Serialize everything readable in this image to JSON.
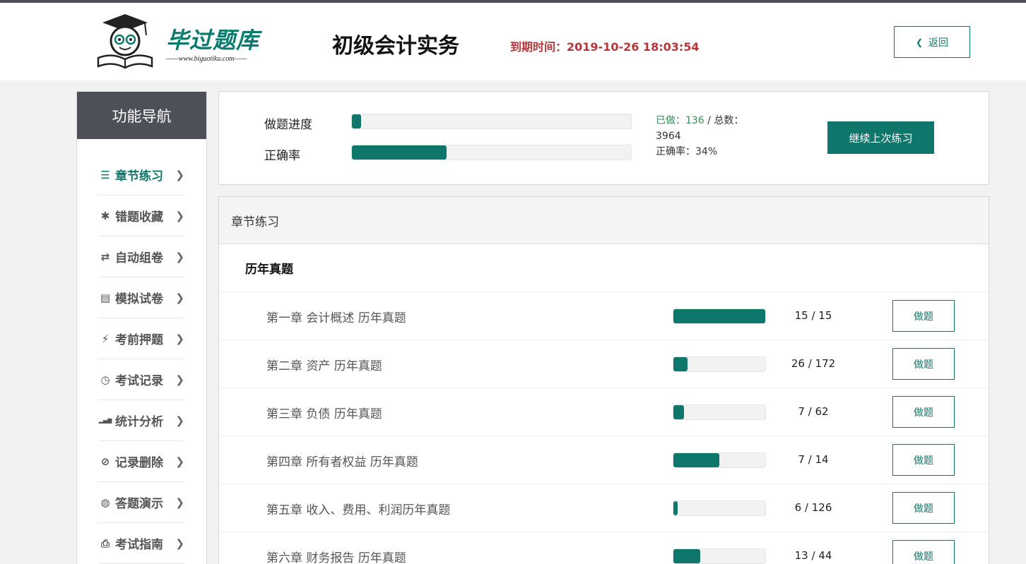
{
  "header": {
    "logo_title": "毕过题库",
    "logo_url": "——www.biguotiku.com——",
    "page_title": "初级会计实务",
    "expire_label": "到期时间：",
    "expire_value": "2019-10-26 18:03:54",
    "back_label": "返回",
    "back_icon": "chevron-left-icon"
  },
  "sidebar": {
    "title": "功能导航",
    "items": [
      {
        "label": "章节练习",
        "icon": "list-icon",
        "glyph": "☰",
        "active": true
      },
      {
        "label": "错题收藏",
        "icon": "asterisk-icon",
        "glyph": "✱",
        "active": false
      },
      {
        "label": "自动组卷",
        "icon": "retweet-icon",
        "glyph": "⇄",
        "active": false
      },
      {
        "label": "模拟试卷",
        "icon": "list-alt-icon",
        "glyph": "▤",
        "active": false
      },
      {
        "label": "考前押题",
        "icon": "flash-icon",
        "glyph": "⚡",
        "active": false
      },
      {
        "label": "考试记录",
        "icon": "clock-icon",
        "glyph": "◷",
        "active": false
      },
      {
        "label": "统计分析",
        "icon": "signal-icon",
        "glyph": "▂▄▆",
        "active": false
      },
      {
        "label": "记录删除",
        "icon": "ban-icon",
        "glyph": "⊘",
        "active": false
      },
      {
        "label": "答题演示",
        "icon": "globe-icon",
        "glyph": "◍",
        "active": false
      },
      {
        "label": "考试指南",
        "icon": "print-icon",
        "glyph": "⎙",
        "active": false
      }
    ]
  },
  "progress": {
    "progress_label": "做题进度",
    "accuracy_label": "正确率",
    "progress_fraction": 0.034,
    "accuracy_fraction": 0.34,
    "done_label": "已做：",
    "done_value": "136",
    "total_label": " / 总数：",
    "total_value": "3964",
    "accuracy_text": "正确率：34%",
    "continue_label": "继续上次练习"
  },
  "chapters": {
    "panel_title": "章节练习",
    "section_title": "历年真题",
    "button_label": "做题",
    "rows": [
      {
        "name": "第一章 会计概述 历年真题",
        "count": "15 / 15",
        "fraction": 1.0
      },
      {
        "name": "第二章 资产 历年真题",
        "count": "26 / 172",
        "fraction": 0.151
      },
      {
        "name": "第三章 负债 历年真题",
        "count": "7 / 62",
        "fraction": 0.113
      },
      {
        "name": "第四章 所有者权益 历年真题",
        "count": "7 / 14",
        "fraction": 0.5
      },
      {
        "name": "第五章 收入、费用、利润历年真题",
        "count": "6 / 126",
        "fraction": 0.048
      },
      {
        "name": "第六章 财务报告 历年真题",
        "count": "13 / 44",
        "fraction": 0.295
      }
    ]
  },
  "colors": {
    "accent": "#0f766b",
    "expire": "#b5373a",
    "sidebar_head": "#4d5157"
  }
}
